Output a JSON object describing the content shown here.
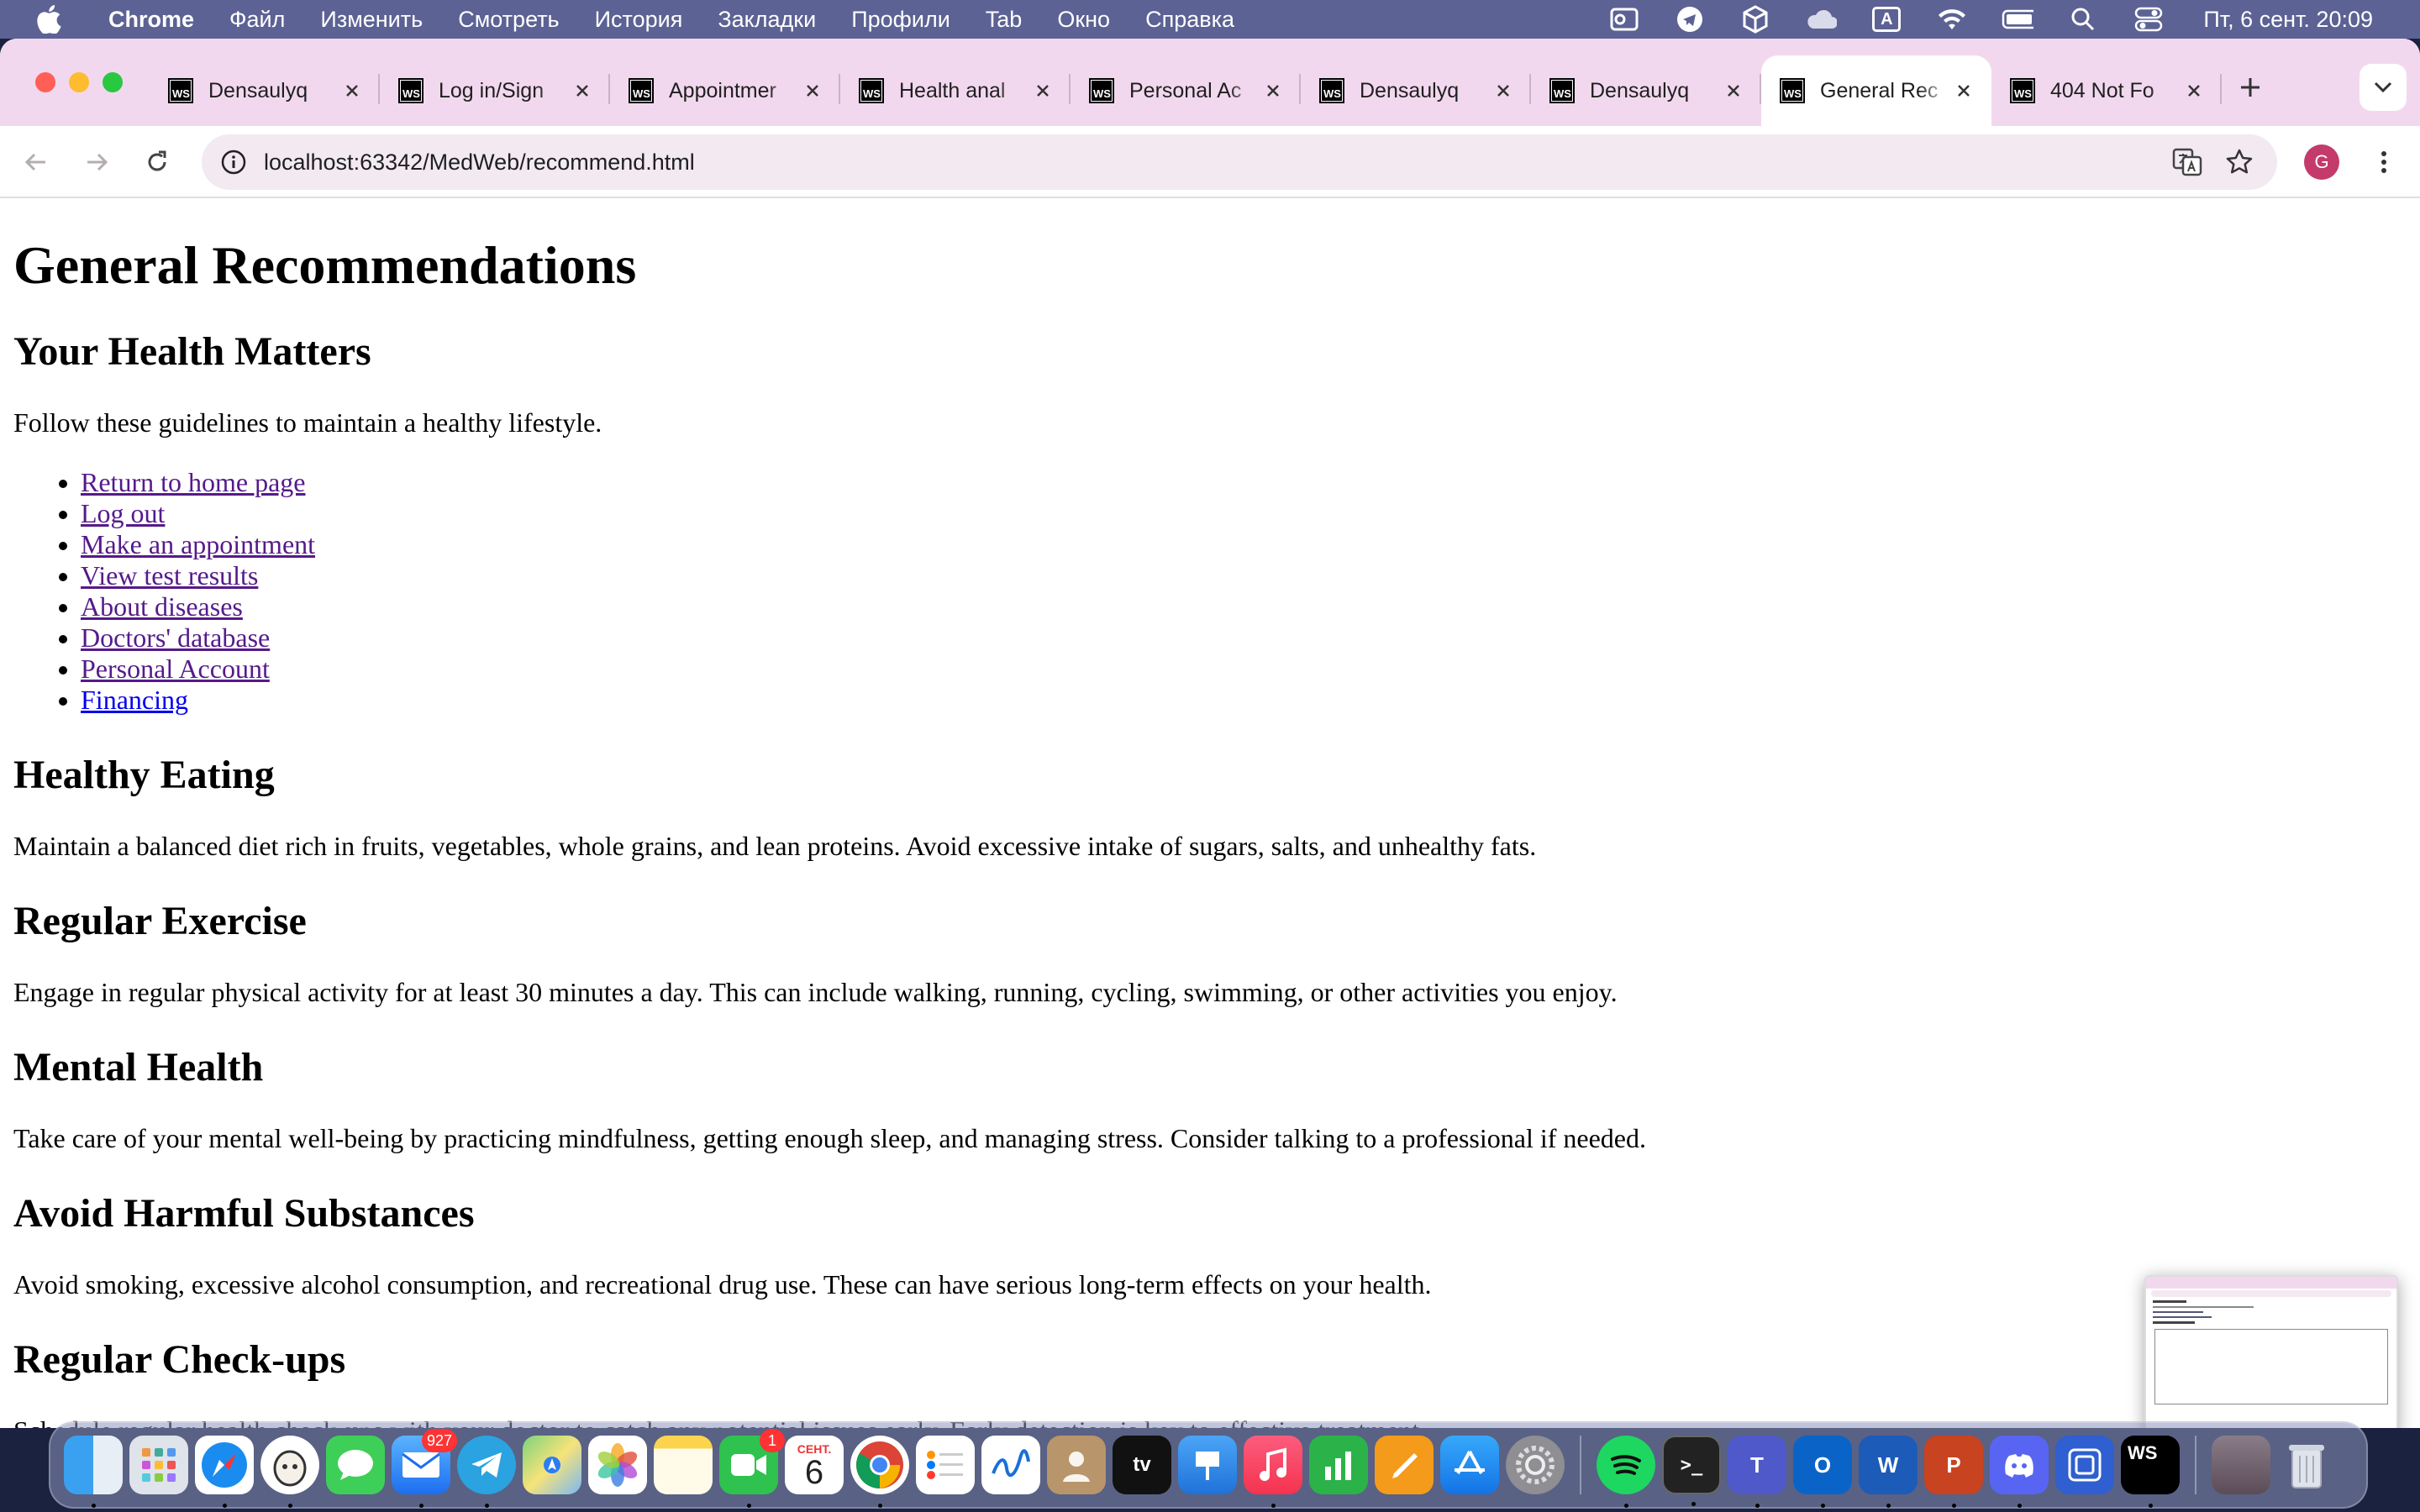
{
  "menubar": {
    "app_name": "Chrome",
    "items": [
      "Файл",
      "Изменить",
      "Смотреть",
      "История",
      "Закладки",
      "Профили",
      "Tab",
      "Окно",
      "Справка"
    ],
    "clock": "Пт, 6 сент.  20:09",
    "input_source": "A"
  },
  "tabs": [
    {
      "title": "Densaulyq"
    },
    {
      "title": "Log in/Sign"
    },
    {
      "title": "Appointmer"
    },
    {
      "title": "Health anal"
    },
    {
      "title": "Personal Ac"
    },
    {
      "title": "Densaulyq"
    },
    {
      "title": "Densaulyq"
    },
    {
      "title": "General Rec"
    },
    {
      "title": "404 Not Fo"
    }
  ],
  "active_tab_index": 7,
  "tab_favicon_text": "WS",
  "address_bar": {
    "url": "localhost:63342/MedWeb/recommend.html"
  },
  "profile": {
    "initial": "G",
    "color": "#c43a6b"
  },
  "page": {
    "title": "General Recommendations",
    "subtitle": "Your Health Matters",
    "intro": "Follow these guidelines to maintain a healthy lifestyle.",
    "nav_links": [
      {
        "label": "Return to home page",
        "visited": true
      },
      {
        "label": "Log out",
        "visited": true
      },
      {
        "label": "Make an appointment",
        "visited": true
      },
      {
        "label": "View test results",
        "visited": true
      },
      {
        "label": "About diseases",
        "visited": true
      },
      {
        "label": "Doctors' database",
        "visited": true
      },
      {
        "label": "Personal Account",
        "visited": true
      },
      {
        "label": "Financing",
        "visited": false
      }
    ],
    "sections": [
      {
        "heading": "Healthy Eating",
        "text": "Maintain a balanced diet rich in fruits, vegetables, whole grains, and lean proteins. Avoid excessive intake of sugars, salts, and unhealthy fats."
      },
      {
        "heading": "Regular Exercise",
        "text": "Engage in regular physical activity for at least 30 minutes a day. This can include walking, running, cycling, swimming, or other activities you enjoy."
      },
      {
        "heading": "Mental Health",
        "text": "Take care of your mental well-being by practicing mindfulness, getting enough sleep, and managing stress. Consider talking to a professional if needed."
      },
      {
        "heading": "Avoid Harmful Substances",
        "text": "Avoid smoking, excessive alcohol consumption, and recreational drug use. These can have serious long-term effects on your health."
      },
      {
        "heading": "Regular Check-ups",
        "text": "Schedule regular health check-ups with your doctor to catch any potential issues early. Early detection is key to effective treatment."
      }
    ]
  },
  "dock": {
    "mail_badge": "927",
    "facetime_badge": "1",
    "calendar_month": "СЕНТ.",
    "calendar_day": "6",
    "webstorm_text": "WS",
    "apps": [
      "finder-icon",
      "launchpad-icon",
      "safari-icon",
      "alpaca-app-icon",
      "messages-icon",
      "mail-icon",
      "telegram-icon",
      "maps-icon",
      "photos-icon",
      "notes-icon",
      "facetime-icon",
      "calendar-icon",
      "chrome-icon",
      "reminders-icon",
      "freeform-icon",
      "contacts-icon",
      "apple-tv-icon",
      "keynote-icon",
      "music-icon",
      "numbers-icon",
      "pages-icon",
      "app-store-icon",
      "system-settings-icon",
      "spotify-icon",
      "terminal-icon",
      "teams-icon",
      "outlook-icon",
      "word-icon",
      "powerpoint-icon",
      "discord-icon",
      "screenshot-icon",
      "webstorm-icon",
      "downloads-stack-icon",
      "trash-icon"
    ]
  }
}
